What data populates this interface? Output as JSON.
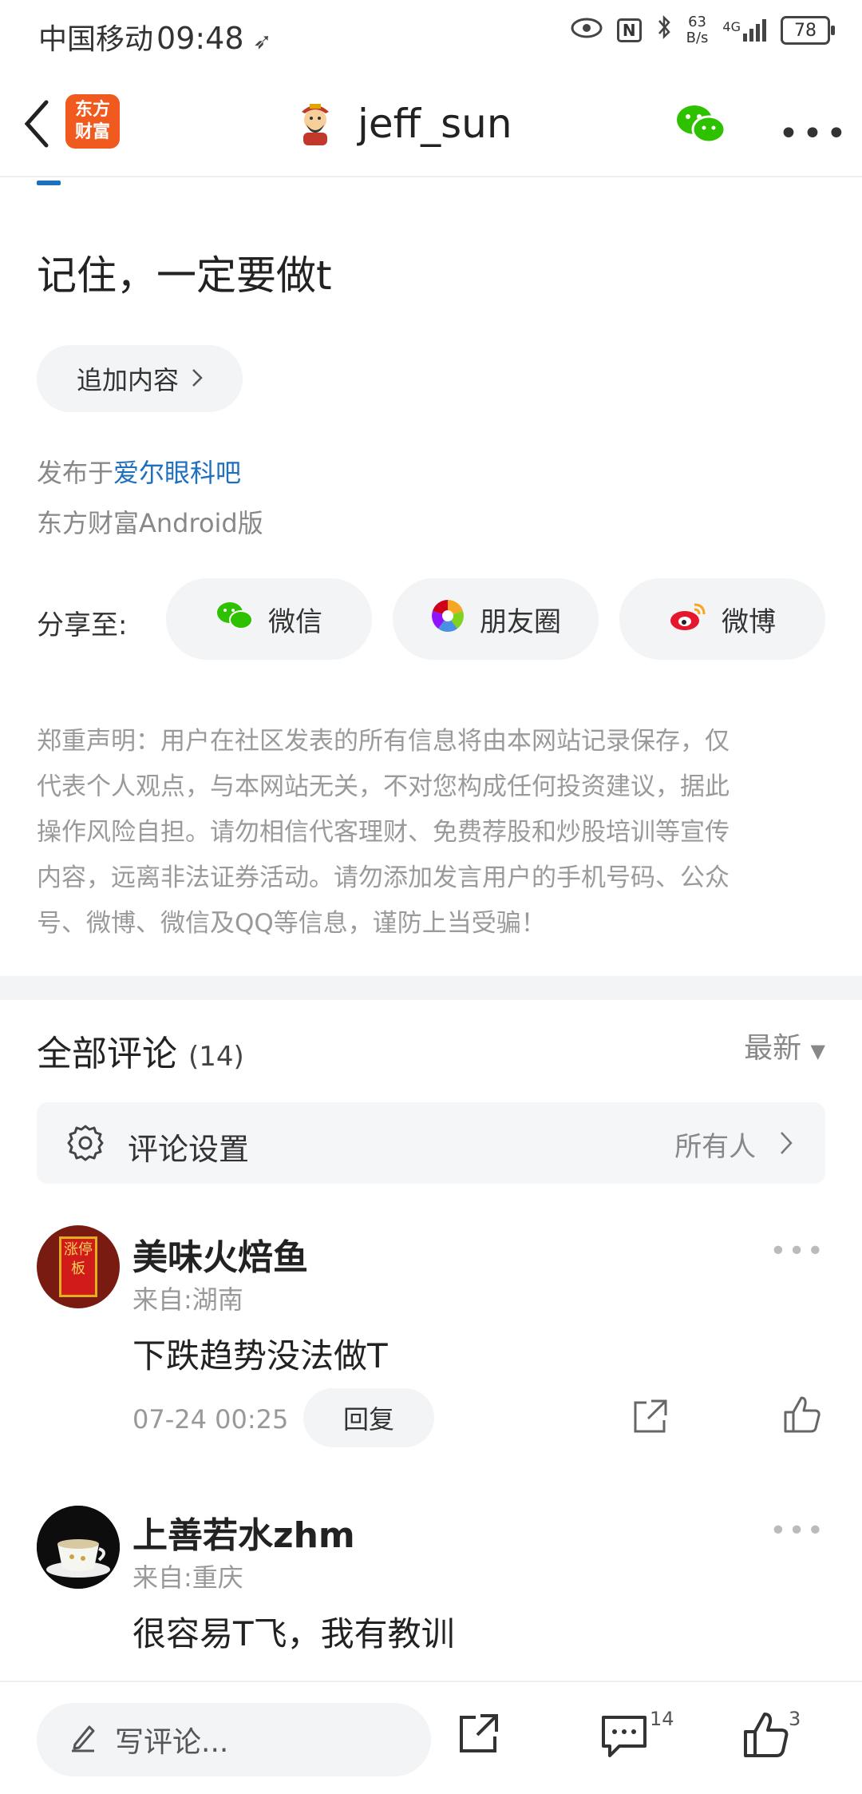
{
  "status_bar": {
    "carrier": "中国移动",
    "time": "09:48",
    "net_speed_value": "63",
    "net_speed_unit": "B/s",
    "signal_label": "4G",
    "battery": "78"
  },
  "nav": {
    "logo_line1": "东方",
    "logo_line2": "财富",
    "title": "jeff_sun"
  },
  "post": {
    "text": "记住，一定要做t",
    "add_content_label": "追加内容",
    "published_prefix": "发布于",
    "forum_link": "爱尔眼科吧",
    "client": "东方财富Android版"
  },
  "share": {
    "label": "分享至:",
    "wechat": "微信",
    "moments": "朋友圈",
    "weibo": "微博"
  },
  "disclaimer": {
    "lines": [
      "郑重声明：用户在社区发表的所有信息将由本网站记录保存，仅",
      "代表个人观点，与本网站无关，不对您构成任何投资建议，据此",
      "操作风险自担。请勿相信代客理财、免费荐股和炒股培训等宣传",
      "内容，远离非法证券活动。请勿添加发言用户的手机号码、公众",
      "号、微博、微信及QQ等信息，谨防上当受骗！"
    ]
  },
  "comments": {
    "title": "全部评论",
    "count": "(14)",
    "sort_label": "最新",
    "settings_label": "评论设置",
    "settings_value": "所有人",
    "items": [
      {
        "name": "美味火焙鱼",
        "avatar_text": "涨停板",
        "from": "来自:湖南",
        "text": "下跌趋势没法做T",
        "time": "07-24 00:25",
        "reply_label": "回复"
      },
      {
        "name": "上善若水zhm",
        "from": "来自:重庆",
        "text": "很容易T飞，我有教训"
      }
    ]
  },
  "bottom_bar": {
    "write_placeholder": "写评论...",
    "comment_count": "14",
    "like_count": "3"
  },
  "colors": {
    "brand_orange": "#f05a1e",
    "link_blue": "#1f6fbf",
    "wechat_green": "#2dc100",
    "weibo_red": "#e6162d"
  }
}
